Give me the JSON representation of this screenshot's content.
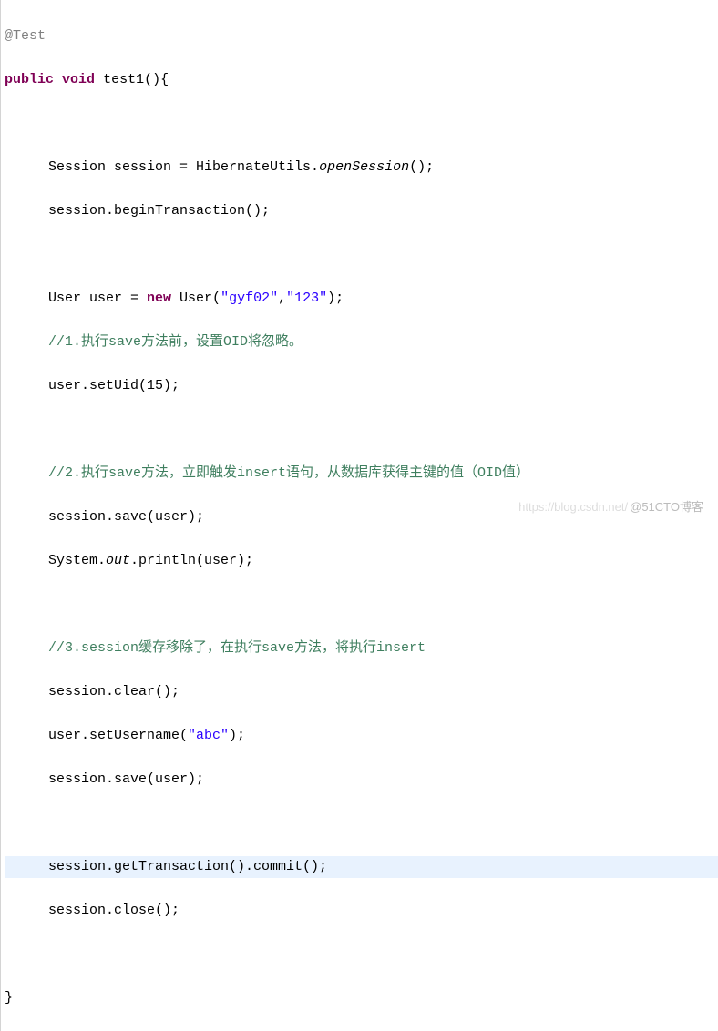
{
  "code": {
    "annotation": "@Test",
    "declaration": {
      "modifier": "public",
      "returnType": "void",
      "name": "test1",
      "params": "()",
      "open": "{"
    },
    "line_session_decl": "Session session = HibernateUtils.",
    "openSession": "openSession",
    "line_session_end": "();",
    "line_begin_tx": "session.beginTransaction();",
    "line_user_decl_a": "User user = ",
    "kw_new": "new",
    "line_user_decl_b": " User(",
    "str_gyf02": "\"gyf02\"",
    "comma": ",",
    "str_123": "\"123\"",
    "line_user_decl_c": ");",
    "comment1": "//1.执行save方法前，设置OID将忽略。",
    "line_setuid": "user.setUid(15);",
    "comment2": "//2.执行save方法，立即触发insert语句，从数据库获得主键的值（OID值）",
    "line_save1": "session.save(user);",
    "line_sysout_a": "System.",
    "sysout_out": "out",
    "line_sysout_b": ".println(user);",
    "comment3": "//3.session缓存移除了，在执行save方法，将执行insert",
    "line_clear": "session.clear();",
    "line_setusername_a": "user.setUsername(",
    "str_abc": "\"abc\"",
    "line_setusername_b": ");",
    "line_save2": "session.save(user);",
    "line_commit": "session.getTransaction().commit();",
    "line_close": "session.close();",
    "close_brace": "}"
  },
  "watermark": {
    "faint": "https://blog.csdn.net/",
    "main": "@51CTO博客"
  }
}
